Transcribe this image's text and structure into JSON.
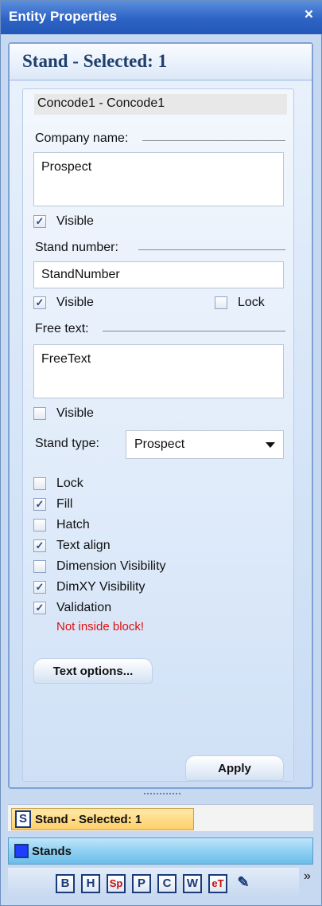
{
  "window": {
    "title": "Entity Properties",
    "close_glyph": "×"
  },
  "panel": {
    "header": "Stand - Selected: 1",
    "entity_title": "Concode1 - Concode1",
    "company": {
      "label": "Company name:",
      "value": "Prospect",
      "visible_label": "Visible",
      "visible_checked": "✓"
    },
    "stand_number": {
      "label": "Stand number:",
      "value": "StandNumber",
      "visible_label": "Visible",
      "visible_checked": "✓",
      "lock_label": "Lock",
      "lock_checked": ""
    },
    "free_text": {
      "label": "Free text:",
      "value": "FreeText",
      "visible_label": "Visible",
      "visible_checked": ""
    },
    "stand_type": {
      "label": "Stand type:",
      "value": "Prospect"
    },
    "options": [
      {
        "label": "Lock",
        "checked": ""
      },
      {
        "label": "Fill",
        "checked": "✓"
      },
      {
        "label": "Hatch",
        "checked": ""
      },
      {
        "label": "Text align",
        "checked": "✓"
      },
      {
        "label": "Dimension Visibility",
        "checked": ""
      },
      {
        "label": "DimXY Visibility",
        "checked": "✓"
      },
      {
        "label": "Validation",
        "checked": "✓"
      }
    ],
    "warning": "Not inside block!",
    "text_options_button": "Text options...",
    "apply_button": "Apply"
  },
  "bottom": {
    "selected_tab": {
      "icon_letter": "S",
      "label": "Stand - Selected: 1"
    },
    "stands_tab": {
      "label": "Stands"
    },
    "toolbar": [
      "B",
      "H",
      "Sp",
      "P",
      "C",
      "W",
      "eT",
      "✎"
    ],
    "overflow": "»"
  },
  "colors": {
    "accent": "#2d63c4",
    "warning": "#e01010",
    "selected_tab": "#ffd06a",
    "stands_tab": "#8fd0f2"
  }
}
